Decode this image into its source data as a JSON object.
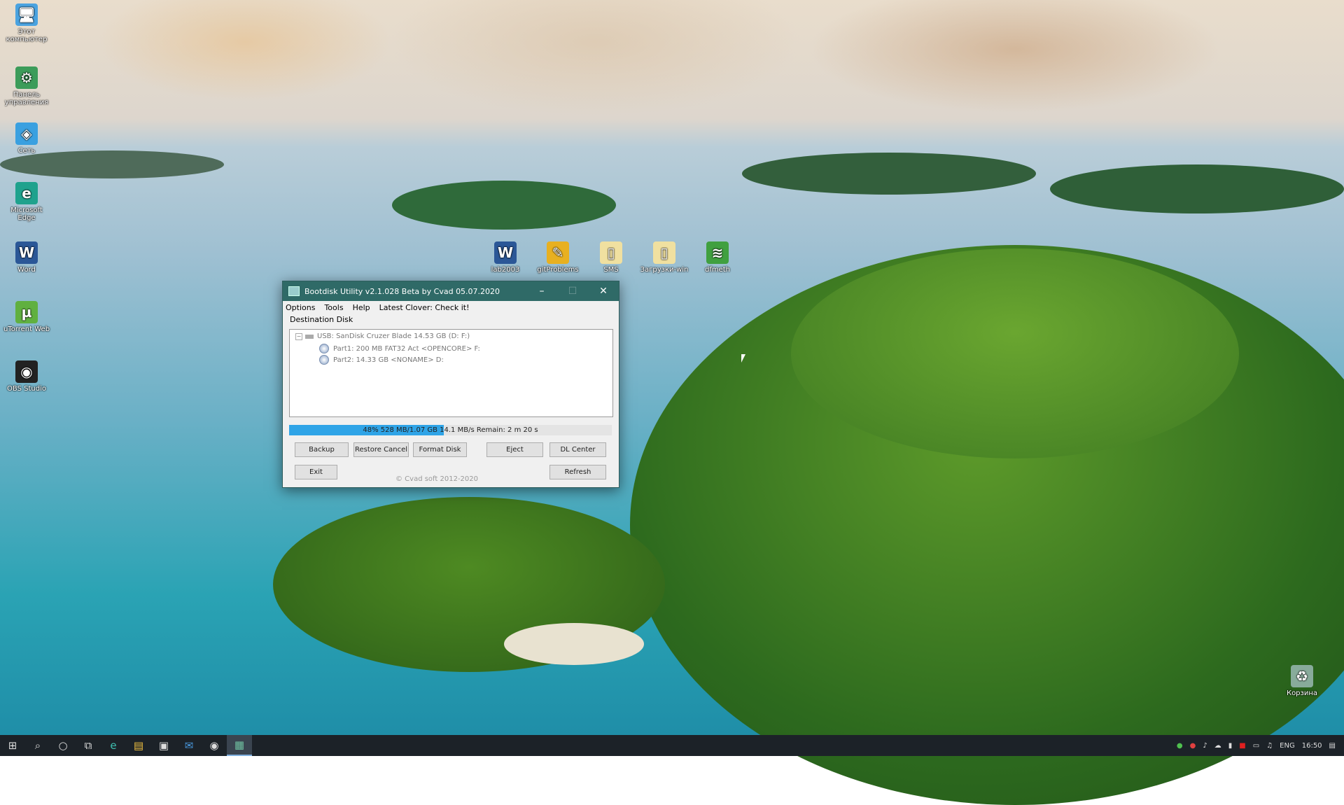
{
  "desktop": {
    "icons_left": [
      {
        "label": "Этот компьютер",
        "icon": "computer-icon",
        "color": "#4aa3e0"
      },
      {
        "label": "Панель управления",
        "icon": "control-panel-icon",
        "color": "#3c9c5a"
      },
      {
        "label": "Сеть",
        "icon": "network-icon",
        "color": "#3aa0e0"
      },
      {
        "label": "Microsoft Edge",
        "icon": "edge-icon",
        "color": "#1fa28d"
      },
      {
        "label": "Word",
        "icon": "word-icon",
        "color": "#2b5797"
      },
      {
        "label": "uTorrent Web",
        "icon": "utorrent-icon",
        "color": "#60b040"
      },
      {
        "label": "OBS Studio",
        "icon": "obs-icon",
        "color": "#222222"
      }
    ],
    "icons_top": [
      {
        "label": "lab2003",
        "icon": "word-doc-icon",
        "color": "#2b5797"
      },
      {
        "label": "gitProblems",
        "icon": "notepad-icon",
        "color": "#e8b020"
      },
      {
        "label": "SMS",
        "icon": "file-icon",
        "color": "#f0e0a0"
      },
      {
        "label": "Загрузки-win",
        "icon": "file-icon",
        "color": "#f0e0a0"
      },
      {
        "label": "dfmeth",
        "icon": "script-icon",
        "color": "#40a040"
      }
    ],
    "recycle_bin": "Корзина"
  },
  "window": {
    "title": "Bootdisk Utility v2.1.028 Beta by Cvad 05.07.2020",
    "controls": {
      "minimize": "–",
      "maximize": "☐",
      "close": "✕"
    },
    "menu": [
      "Options",
      "Tools",
      "Help",
      "Latest Clover: Check it!"
    ],
    "destination_label": "Destination Disk",
    "tree": {
      "root": "USB: SanDisk Cruzer Blade 14.53 GB (D: F:)",
      "parts": [
        "Part1: 200 MB FAT32 Act <OPENCORE> F:",
        "Part2: 14.33 GB <NONAME> D:"
      ]
    },
    "progress": {
      "fraction": 0.48,
      "text": "48% 528 MB/1.07 GB 14.1 MB/s  Remain: 2 m 20 s"
    },
    "buttons": {
      "backup": "Backup",
      "restore_cancel": "Restore Cancel",
      "format_disk": "Format Disk",
      "eject": "Eject",
      "dl_center": "DL Center",
      "exit": "Exit",
      "refresh": "Refresh"
    },
    "copyright": "© Cvad soft 2012-2020"
  },
  "taskbar": {
    "start": "⊞",
    "search": "⌕",
    "cortana": "○",
    "taskview": "⧉",
    "edge": "e",
    "explorer": "▤",
    "store": "▣",
    "mail": "✉",
    "obs": "◉",
    "bootdisk": "▦",
    "tray": {
      "language": "ENG",
      "time": "16:50"
    }
  }
}
